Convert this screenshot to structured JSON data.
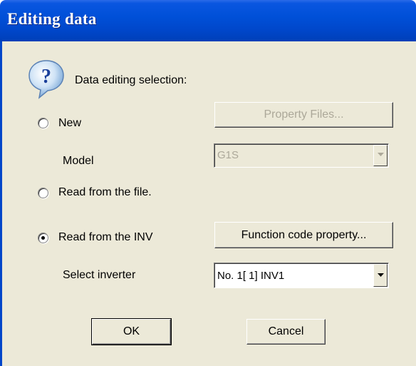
{
  "window": {
    "title": "Editing data"
  },
  "prompt": {
    "text": "Data editing selection:"
  },
  "options": {
    "new": {
      "label": "New",
      "selected": false
    },
    "read_file": {
      "label": "Read from the file.",
      "selected": false
    },
    "read_inv": {
      "label": "Read from the INV",
      "selected": true
    }
  },
  "property_files_button": {
    "label": "Property Files...",
    "enabled": false
  },
  "model": {
    "label": "Model",
    "value": "G1S",
    "enabled": false
  },
  "function_code_button": {
    "label": "Function code property..."
  },
  "inverter": {
    "label": "Select inverter",
    "value": "No. 1[  1] INV1"
  },
  "ok_button": {
    "label": "OK"
  },
  "cancel_button": {
    "label": "Cancel"
  }
}
